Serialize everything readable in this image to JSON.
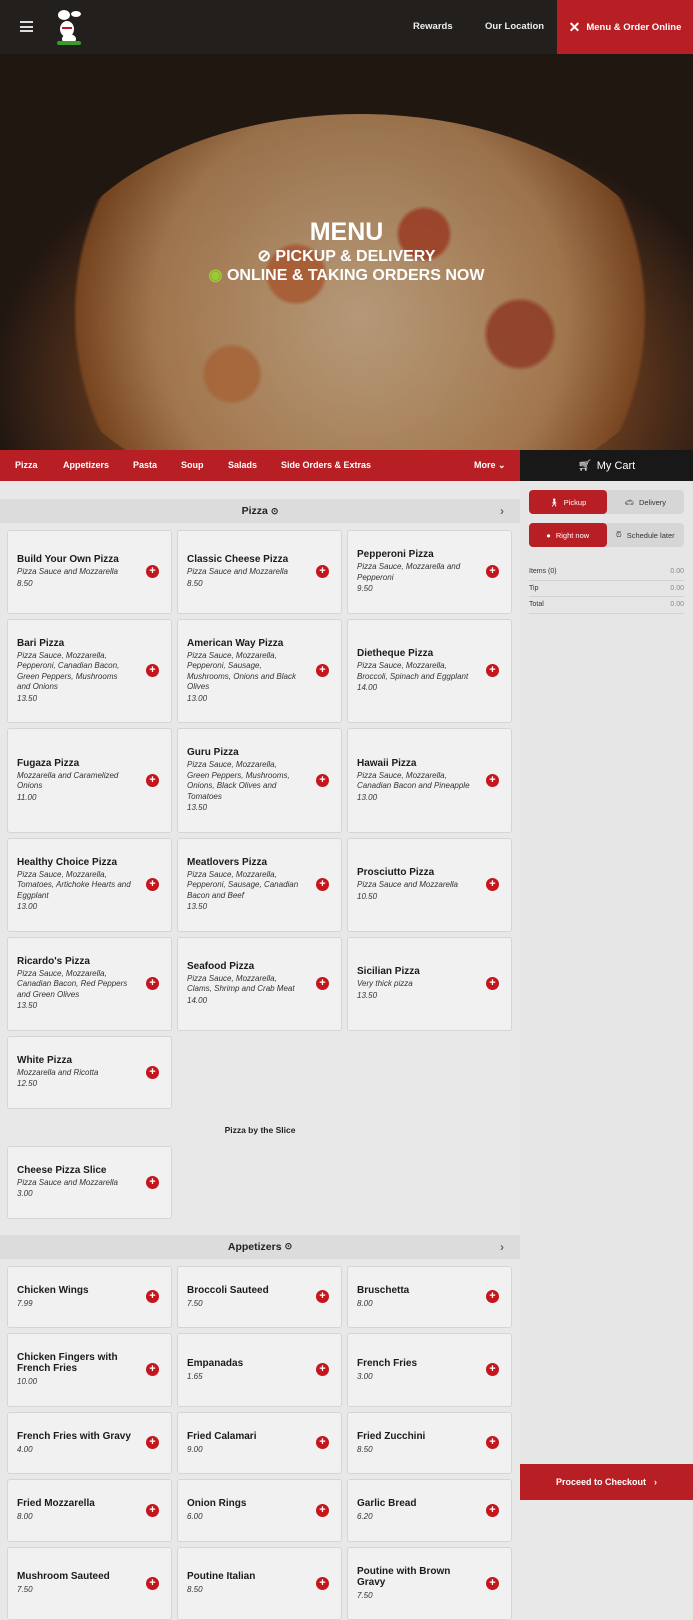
{
  "header": {
    "rewards": "Rewards",
    "location": "Our Location",
    "order": "Menu & Order Online"
  },
  "hero": {
    "title": "MENU",
    "line1": "PICKUP & DELIVERY",
    "line2": "ONLINE & TAKING ORDERS NOW"
  },
  "categories": [
    "Pizza",
    "Appetizers",
    "Pasta",
    "Soup",
    "Salads",
    "Side Orders & Extras"
  ],
  "more": "More",
  "cart": {
    "title": "My Cart",
    "pickup": "Pickup",
    "delivery": "Delivery",
    "now": "Right now",
    "later": "Schedule later",
    "rows": [
      {
        "label": "Items (0)",
        "value": "0.00"
      },
      {
        "label": "Tip",
        "value": "0.00"
      },
      {
        "label": "Total",
        "value": "0.00"
      }
    ],
    "checkout": "Proceed to Checkout"
  },
  "sections": [
    {
      "title": "Pizza",
      "groups": [
        {
          "subtitle": "",
          "items": [
            {
              "name": "Build Your Own Pizza",
              "desc": "Pizza Sauce and Mozzarella",
              "price": "8.50"
            },
            {
              "name": "Classic Cheese Pizza",
              "desc": "Pizza Sauce and Mozzarella",
              "price": "8.50"
            },
            {
              "name": "Pepperoni Pizza",
              "desc": "Pizza Sauce, Mozzarella and Pepperoni",
              "price": "9.50"
            },
            {
              "name": "Bari Pizza",
              "desc": "Pizza Sauce, Mozzarella, Pepperoni, Canadian Bacon, Green Peppers, Mushrooms and Onions",
              "price": "13.50"
            },
            {
              "name": "American Way Pizza",
              "desc": "Pizza Sauce, Mozzarella, Pepperoni, Sausage, Mushrooms, Onions and Black Olives",
              "price": "13.00"
            },
            {
              "name": "Dietheque Pizza",
              "desc": "Pizza Sauce, Mozzarella, Broccoli, Spinach and Eggplant",
              "price": "14.00"
            },
            {
              "name": "Fugaza Pizza",
              "desc": "Mozzarella and Caramelized Onions",
              "price": "11.00"
            },
            {
              "name": "Guru Pizza",
              "desc": "Pizza Sauce, Mozzarella, Green Peppers, Mushrooms, Onions, Black Olives and Tomatoes",
              "price": "13.50"
            },
            {
              "name": "Hawaii Pizza",
              "desc": "Pizza Sauce, Mozzarella, Canadian Bacon and Pineapple",
              "price": "13.00"
            },
            {
              "name": "Healthy Choice Pizza",
              "desc": "Pizza Sauce, Mozzarella, Tomatoes, Artichoke Hearts and Eggplant",
              "price": "13.00"
            },
            {
              "name": "Meatlovers Pizza",
              "desc": "Pizza Sauce, Mozzarella, Pepperoni, Sausage, Canadian Bacon and Beef",
              "price": "13.50"
            },
            {
              "name": "Prosciutto Pizza",
              "desc": "Pizza Sauce and Mozzarella",
              "price": "10.50"
            },
            {
              "name": "Ricardo's Pizza",
              "desc": "Pizza Sauce, Mozzarella, Canadian Bacon, Red Peppers and Green Olives",
              "price": "13.50"
            },
            {
              "name": "Seafood Pizza",
              "desc": "Pizza Sauce, Mozzarella, Clams, Shrimp and Crab Meat",
              "price": "14.00"
            },
            {
              "name": "Sicilian Pizza",
              "desc": "Very thick pizza",
              "price": "13.50"
            },
            {
              "name": "White Pizza",
              "desc": "Mozzarella and Ricotta",
              "price": "12.50"
            }
          ]
        },
        {
          "subtitle": "Pizza by the Slice",
          "items": [
            {
              "name": "Cheese Pizza Slice",
              "desc": "Pizza Sauce and Mozzarella",
              "price": "3.00"
            }
          ]
        }
      ]
    },
    {
      "title": "Appetizers",
      "groups": [
        {
          "subtitle": "",
          "items": [
            {
              "name": "Chicken Wings",
              "desc": "",
              "price": "7.99"
            },
            {
              "name": "Broccoli Sauteed",
              "desc": "",
              "price": "7.50"
            },
            {
              "name": "Bruschetta",
              "desc": "",
              "price": "8.00"
            },
            {
              "name": "Chicken Fingers with French Fries",
              "desc": "",
              "price": "10.00"
            },
            {
              "name": "Empanadas",
              "desc": "",
              "price": "1.65"
            },
            {
              "name": "French Fries",
              "desc": "",
              "price": "3.00"
            },
            {
              "name": "French Fries with Gravy",
              "desc": "",
              "price": "4.00"
            },
            {
              "name": "Fried Calamari",
              "desc": "",
              "price": "9.00"
            },
            {
              "name": "Fried Zucchini",
              "desc": "",
              "price": "8.50"
            },
            {
              "name": "Fried Mozzarella",
              "desc": "",
              "price": "8.00"
            },
            {
              "name": "Onion Rings",
              "desc": "",
              "price": "6.00"
            },
            {
              "name": "Garlic Bread",
              "desc": "",
              "price": "6.20"
            },
            {
              "name": "Mushroom Sauteed",
              "desc": "",
              "price": "7.50"
            },
            {
              "name": "Poutine Italian",
              "desc": "",
              "price": "8.50"
            },
            {
              "name": "Poutine with Brown Gravy",
              "desc": "",
              "price": "7.50"
            }
          ]
        }
      ]
    }
  ]
}
